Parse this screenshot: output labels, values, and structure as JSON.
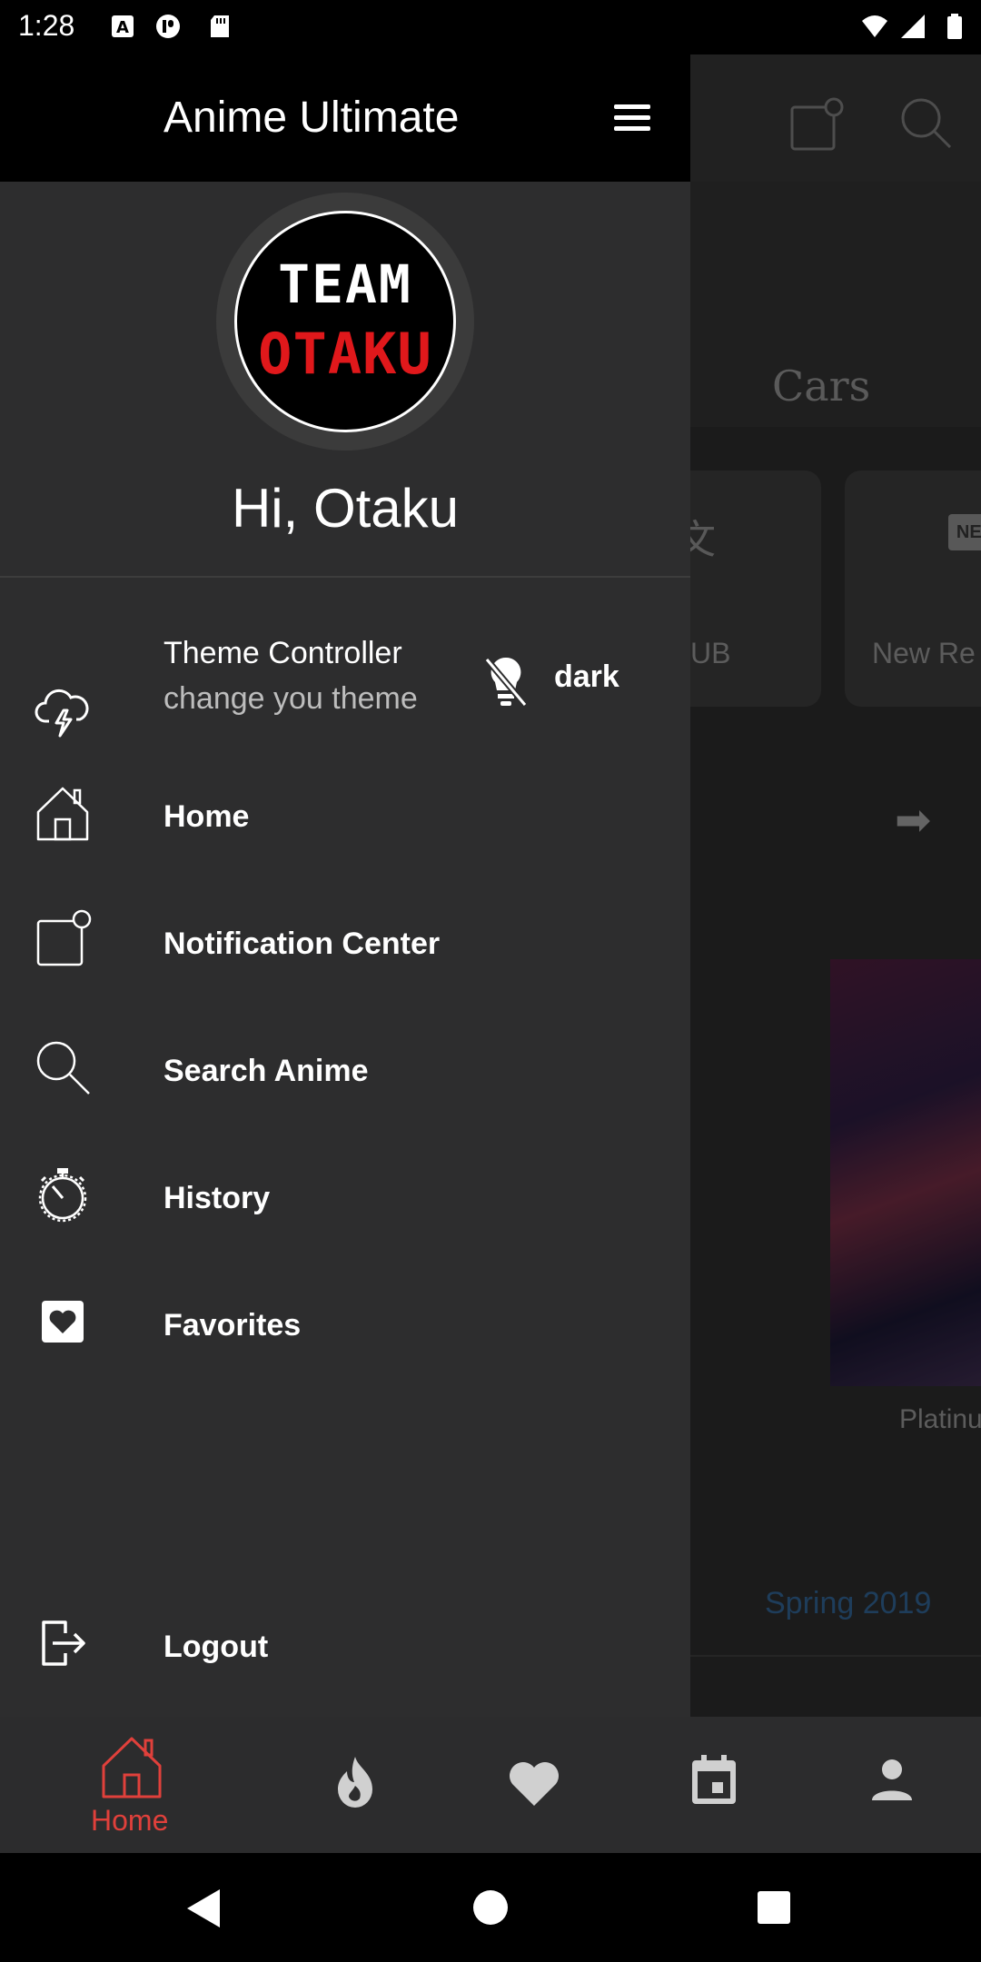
{
  "status_bar": {
    "time": "1:28",
    "icons": [
      "a-icon",
      "p-icon",
      "sd-card-icon",
      "wifi-icon",
      "cell-signal-icon",
      "battery-icon"
    ]
  },
  "background_app": {
    "tab_label": "Cars",
    "cards": [
      {
        "label": "UB"
      },
      {
        "label": "New Re",
        "badge": "NEU"
      }
    ],
    "poster_caption": "Platinu",
    "season_link": "Spring 2019"
  },
  "drawer": {
    "title": "Anime Ultimate",
    "avatar_text_top": "TEAM",
    "avatar_text_bottom": "OTAKU",
    "greeting": "Hi, Otaku",
    "theme": {
      "title": "Theme Controller",
      "subtitle": "change you theme",
      "value": "dark"
    },
    "items": [
      {
        "label": "Home",
        "icon": "home-icon"
      },
      {
        "label": "Notification Center",
        "icon": "notification-icon"
      },
      {
        "label": "Search Anime",
        "icon": "search-icon"
      },
      {
        "label": "History",
        "icon": "stopwatch-icon"
      },
      {
        "label": "Favorites",
        "icon": "heart-box-icon"
      }
    ],
    "logout_label": "Logout"
  },
  "bottom_nav": {
    "items": [
      {
        "label": "Home",
        "icon": "home-icon",
        "active": true
      },
      {
        "label": "",
        "icon": "fire-icon"
      },
      {
        "label": "",
        "icon": "heart-icon"
      },
      {
        "label": "",
        "icon": "calendar-icon"
      },
      {
        "label": "",
        "icon": "person-icon"
      }
    ]
  },
  "colors": {
    "accent": "#e0403b",
    "drawer_bg": "#2d2d2e",
    "header_bg": "#000000",
    "link_blue": "#2f5f8c"
  }
}
